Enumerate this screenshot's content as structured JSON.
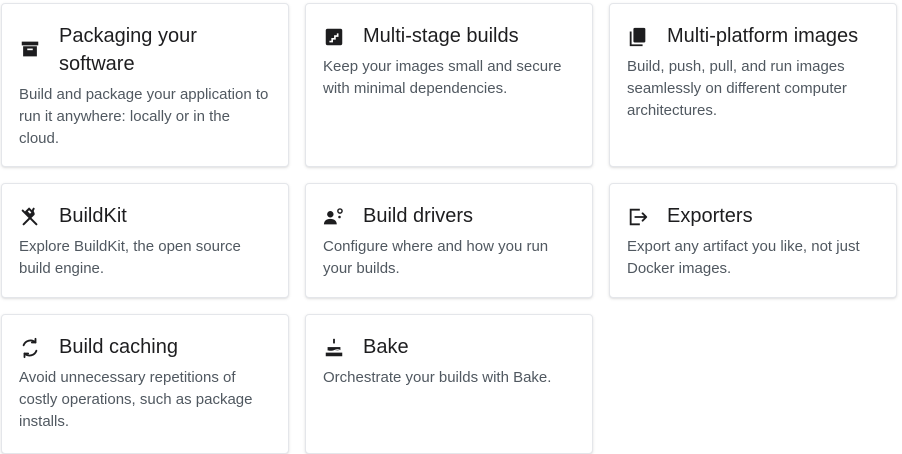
{
  "cards": [
    {
      "icon": "archive-box-icon",
      "title": "Packaging your software",
      "description": "Build and package your application to run it anywhere: locally or in the cloud."
    },
    {
      "icon": "stairs-icon",
      "title": "Multi-stage builds",
      "description": "Keep your images small and secure with minimal dependencies."
    },
    {
      "icon": "layered-pages-icon",
      "title": "Multi-platform images",
      "description": "Build, push, pull, and run images seamlessly on different computer architectures."
    },
    {
      "icon": "hammer-wrench-icon",
      "title": "BuildKit",
      "description": "Explore BuildKit, the open source build engine."
    },
    {
      "icon": "person-gear-icon",
      "title": "Build drivers",
      "description": "Configure where and how you run your builds."
    },
    {
      "icon": "export-arrow-icon",
      "title": "Exporters",
      "description": "Export any artifact you like, not just Docker images."
    },
    {
      "icon": "refresh-cycle-icon",
      "title": "Build caching",
      "description": "Avoid unnecessary repetitions of costly operations, such as package installs."
    },
    {
      "icon": "cake-icon",
      "title": "Bake",
      "description": "Orchestrate your builds with Bake."
    }
  ],
  "colors": {
    "title": "#1d1d1f",
    "description": "#505860",
    "icon": "#1d1d1f",
    "border": "#e4e6ea"
  }
}
